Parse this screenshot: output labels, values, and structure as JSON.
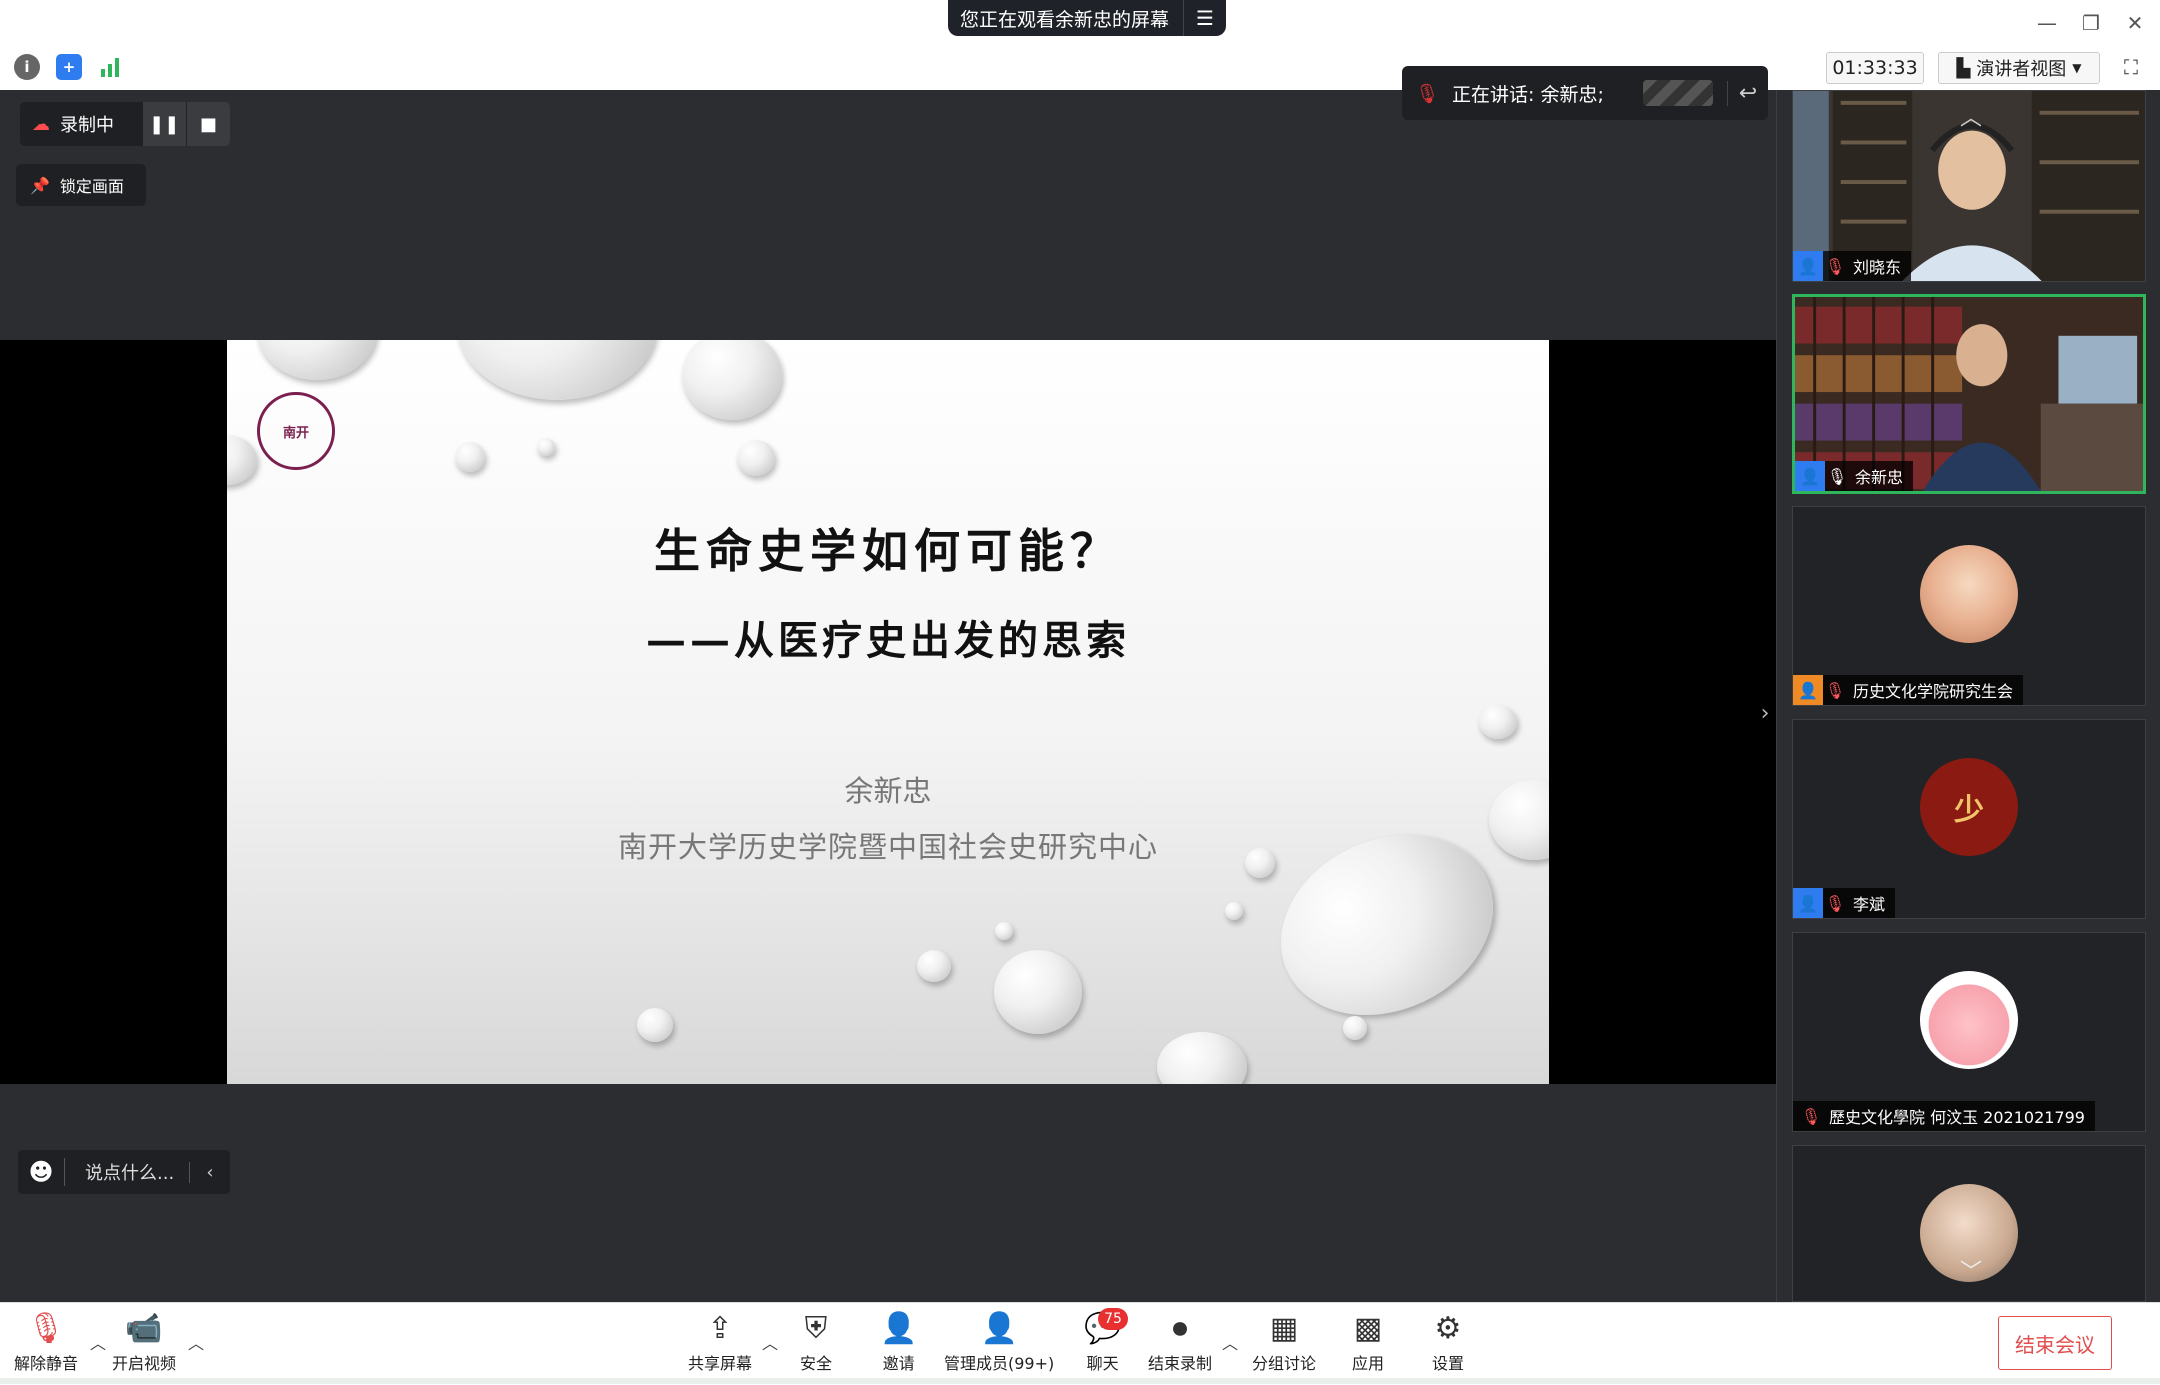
{
  "window": {
    "viewing_banner": "您正在观看余新忠的屏幕",
    "minimize": "—",
    "restore": "❐",
    "close": "✕"
  },
  "infobar": {
    "timer": "01:33:33",
    "view_mode": "演讲者视图"
  },
  "overlay": {
    "recording_label": "录制中",
    "lock_label": "锁定画面",
    "speaking_label": "正在讲话: 余新忠;",
    "chat_placeholder": "说点什么..."
  },
  "slide": {
    "logo_text": "南开",
    "title": "生命史学如何可能？",
    "subtitle": "——从医疗史出发的思索",
    "author": "余新忠",
    "affiliation": "南开大学历史学院暨中国社会史研究中心"
  },
  "participants": [
    {
      "name": "刘晓东",
      "role": "participant",
      "muted": true,
      "type": "video"
    },
    {
      "name": "余新忠",
      "role": "participant",
      "muted": false,
      "type": "video",
      "active": true
    },
    {
      "name": "历史文化学院研究生会",
      "role": "host",
      "muted": true,
      "type": "avatar"
    },
    {
      "name": "李斌",
      "role": "participant",
      "muted": true,
      "type": "avatar"
    },
    {
      "name": "歷史文化學院 何汶玉 2021021799",
      "role": "none",
      "muted": true,
      "type": "avatar"
    },
    {
      "name": "",
      "role": "none",
      "muted": true,
      "type": "avatar"
    }
  ],
  "toolbar": {
    "unmute": "解除静音",
    "start_video": "开启视频",
    "share_screen": "共享屏幕",
    "security": "安全",
    "invite": "邀请",
    "manage_members": "管理成员(99+)",
    "chat": "聊天",
    "chat_badge": "75",
    "stop_recording": "结束录制",
    "breakout": "分组讨论",
    "apps": "应用",
    "settings": "设置",
    "end_meeting": "结束会议"
  },
  "colors": {
    "accent_green": "#2fb55c",
    "danger_red": "#e34d4d",
    "host_orange": "#f08a24",
    "participant_blue": "#2f7bf0"
  }
}
